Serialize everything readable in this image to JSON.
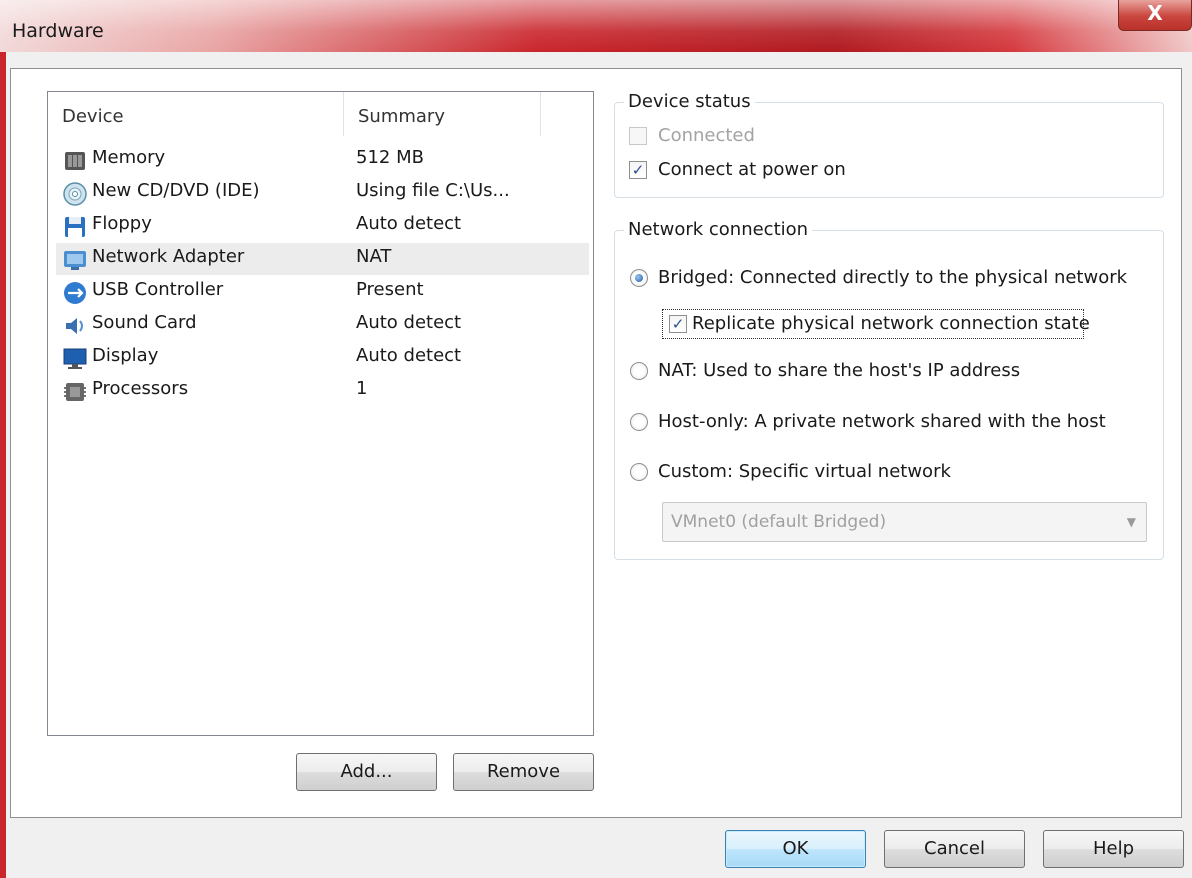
{
  "window": {
    "title": "Hardware",
    "close_label": "X"
  },
  "device_list": {
    "columns": [
      "Device",
      "Summary"
    ],
    "rows": [
      {
        "name": "Memory",
        "summary": "512 MB",
        "icon": "memory-icon"
      },
      {
        "name": "New CD/DVD (IDE)",
        "summary": "Using file C:\\Us...",
        "icon": "cd-dvd-icon"
      },
      {
        "name": "Floppy",
        "summary": "Auto detect",
        "icon": "floppy-icon"
      },
      {
        "name": "Network Adapter",
        "summary": "NAT",
        "icon": "network-adapter-icon",
        "selected": true
      },
      {
        "name": "USB Controller",
        "summary": "Present",
        "icon": "usb-icon"
      },
      {
        "name": "Sound Card",
        "summary": "Auto detect",
        "icon": "sound-card-icon"
      },
      {
        "name": "Display",
        "summary": "Auto detect",
        "icon": "display-icon"
      },
      {
        "name": "Processors",
        "summary": "1",
        "icon": "processor-icon"
      }
    ]
  },
  "list_buttons": {
    "add": "Add...",
    "remove": "Remove"
  },
  "device_status": {
    "title": "Device status",
    "connected": {
      "label": "Connected",
      "checked": false,
      "enabled": false
    },
    "connect_at_power_on": {
      "label": "Connect at power on",
      "checked": true
    }
  },
  "network_connection": {
    "title": "Network connection",
    "bridged": {
      "label": "Bridged: Connected directly to the physical network",
      "selected": true
    },
    "replicate": {
      "label": "Replicate physical network connection state",
      "checked": true
    },
    "nat": {
      "label": "NAT: Used to share the host's IP address"
    },
    "host_only": {
      "label": "Host-only: A private network shared with the host"
    },
    "custom": {
      "label": "Custom: Specific virtual network"
    },
    "vmnet_select": {
      "value": "VMnet0 (default Bridged)"
    }
  },
  "dialog_buttons": {
    "ok": "OK",
    "cancel": "Cancel",
    "help": "Help"
  },
  "colors": {
    "titlebar_accent": "#c9262c",
    "selection": "#ececec",
    "default_button": "#bee6fd"
  }
}
